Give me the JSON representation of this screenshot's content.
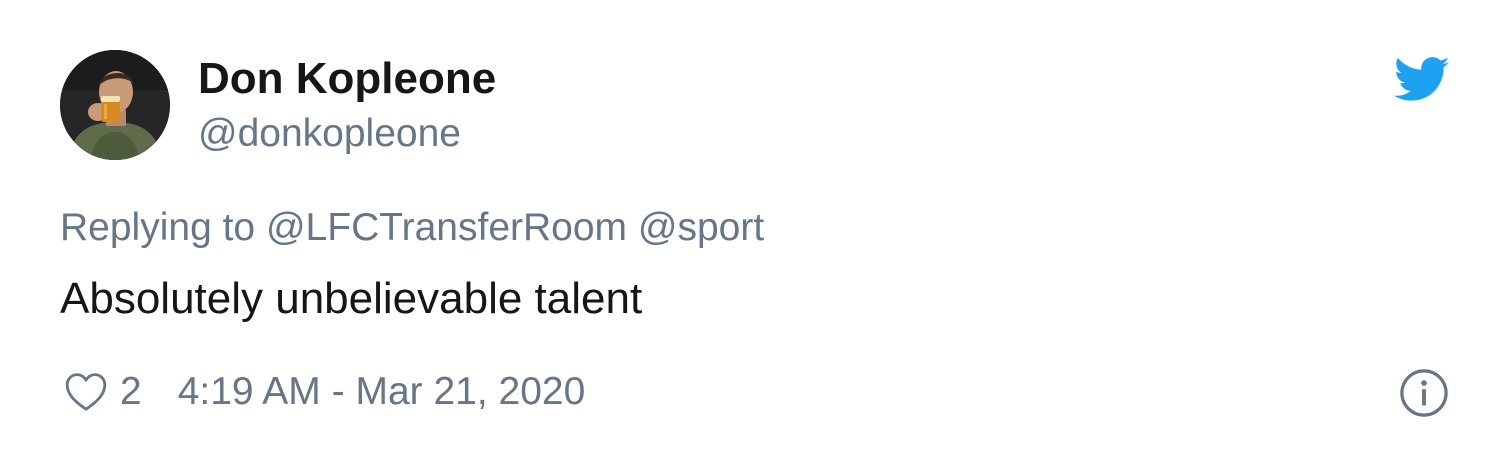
{
  "tweet": {
    "author": {
      "display_name": "Don Kopleone",
      "handle": "@donkopleone",
      "avatar_icon": "profile-photo"
    },
    "reply": {
      "prefix": "Replying to",
      "mentions": [
        "@LFCTransferRoom",
        "@sport"
      ]
    },
    "text": "Absolutely unbelievable talent",
    "likes": "2",
    "timestamp": "4:19 AM - Mar 21, 2020",
    "icons": {
      "brand": "twitter-bird-icon",
      "like": "heart-icon",
      "info": "info-icon"
    },
    "colors": {
      "twitter_blue": "#1da1f2",
      "secondary_text": "#657786",
      "primary_text": "#14171a"
    }
  }
}
